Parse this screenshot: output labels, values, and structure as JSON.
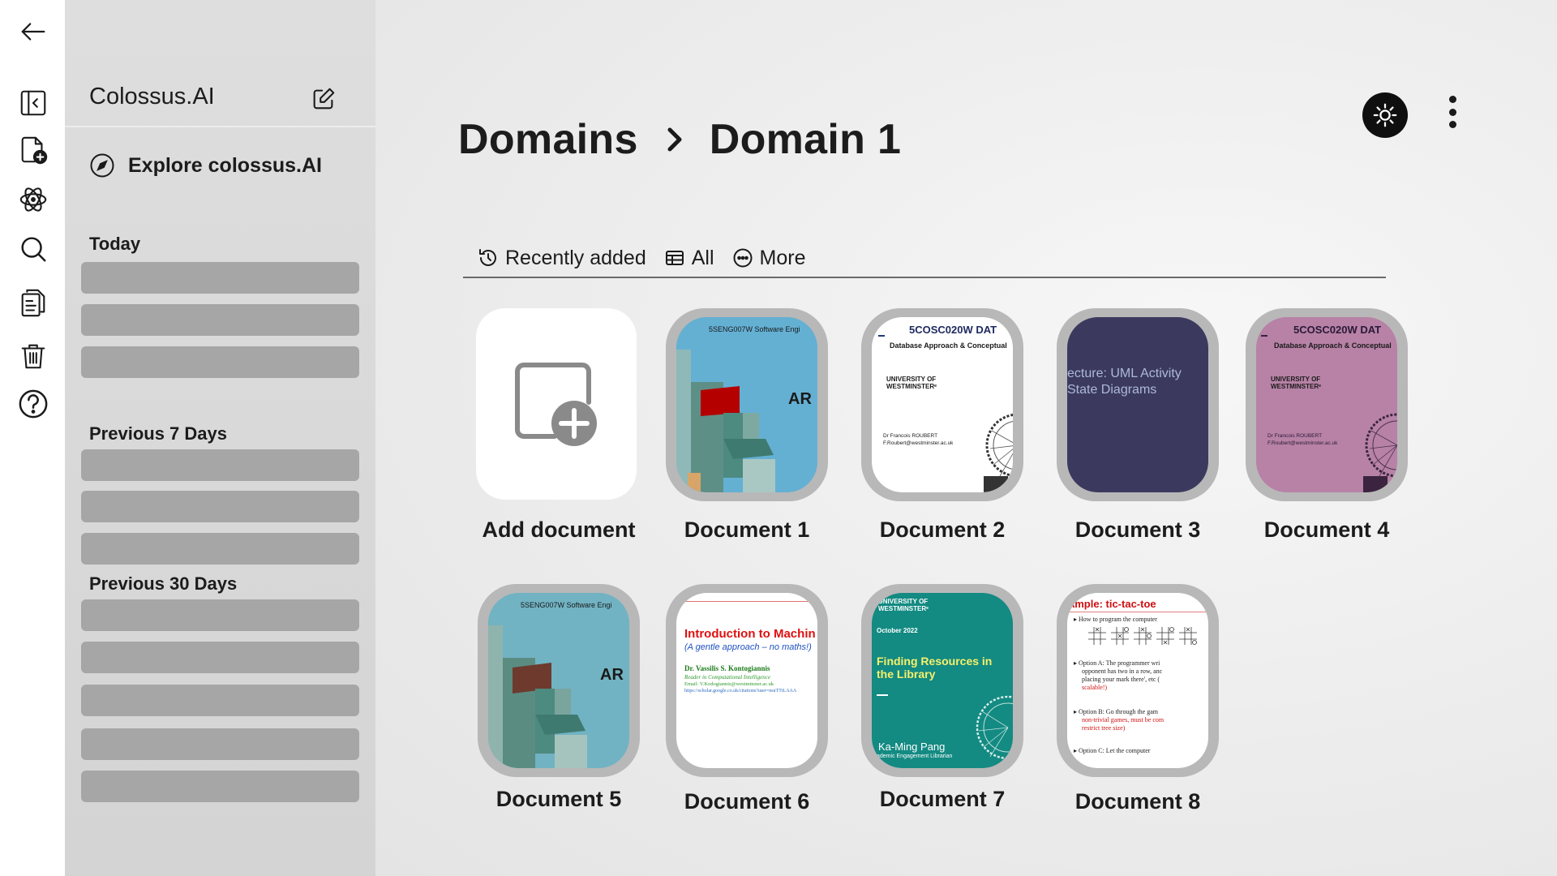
{
  "rail": {
    "icons": [
      "back-arrow-icon",
      "collapse-sidebar-icon",
      "new-document-icon",
      "atom-icon",
      "search-icon",
      "documents-icon",
      "trash-icon",
      "help-icon"
    ]
  },
  "sidebar": {
    "brand": "Colossus.AI",
    "explore_label": "Explore colossus.AI",
    "groups": [
      {
        "title": "Today",
        "item_count": 3
      },
      {
        "title": "Previous 7 Days",
        "item_count": 3
      },
      {
        "title": "Previous 30 Days",
        "item_count": 5
      }
    ]
  },
  "header": {
    "breadcrumbs": [
      "Domains",
      "Domain 1"
    ]
  },
  "tabs": [
    {
      "label": "Recently added",
      "icon": "history-icon"
    },
    {
      "label": "All",
      "icon": "table-icon"
    },
    {
      "label": "More",
      "icon": "more-circle-icon"
    }
  ],
  "cards": {
    "add_label": "Add document",
    "documents": [
      {
        "label": "Document 1"
      },
      {
        "label": "Document 2"
      },
      {
        "label": "Document 3"
      },
      {
        "label": "Document 4"
      },
      {
        "label": "Document 5"
      },
      {
        "label": "Document 6"
      },
      {
        "label": "Document 7"
      },
      {
        "label": "Document 8"
      }
    ]
  },
  "thumbs": {
    "d1_header": "5SENG007W Software Engi",
    "d1_big": "AR",
    "d2_title": "5COSC020W DAT",
    "d2_sub": "Database Approach & Conceptual",
    "d2_uni1": "UNIVERSITY OF",
    "d2_uni2": "WESTMINSTERᵉ",
    "d2_author": "Dr Francois ROUBERT",
    "d2_email": "F.Roubert@westminster.ac.uk",
    "d3_line1": "ecture: UML Activity",
    "d3_line2": "State Diagrams",
    "d6_title": "Introduction to Machin",
    "d6_sub": "(A gentle approach – no maths!)",
    "d6_author": "Dr. Vassilis S. Kontogiannis",
    "d6_role": "Reader in Computational Intelligence",
    "d6_email": "Email: V.Kodogiannis@westminster.ac.uk",
    "d6_link": "https://scholar.google.co.uk/citations?user=nsuTTtLAAA",
    "d7_uni1": "UNIVERSITY OF",
    "d7_uni2": "WESTMINSTERᵉ",
    "d7_date": "October 2022",
    "d7_title1": "Finding Resources in",
    "d7_title2": "the Library",
    "d7_name": "Ka-Ming Pang",
    "d7_role": "ademic Engagement Librarian",
    "d8_title": "ample: tic-tac-toe",
    "d8_b1": "How to program the computer",
    "d8_b2a": "Option A: The programmer wri",
    "d8_b2b": "opponent has two in a row, anc",
    "d8_b2c": "placing your mark there', etc (",
    "d8_b2d": "scalable!)",
    "d8_b3a": "Option B: Go through the gam",
    "d8_b3b": "non-trivial games, must be com",
    "d8_b3c": "restrict tree size)",
    "d8_b4a": "Option C: Let the computer"
  }
}
